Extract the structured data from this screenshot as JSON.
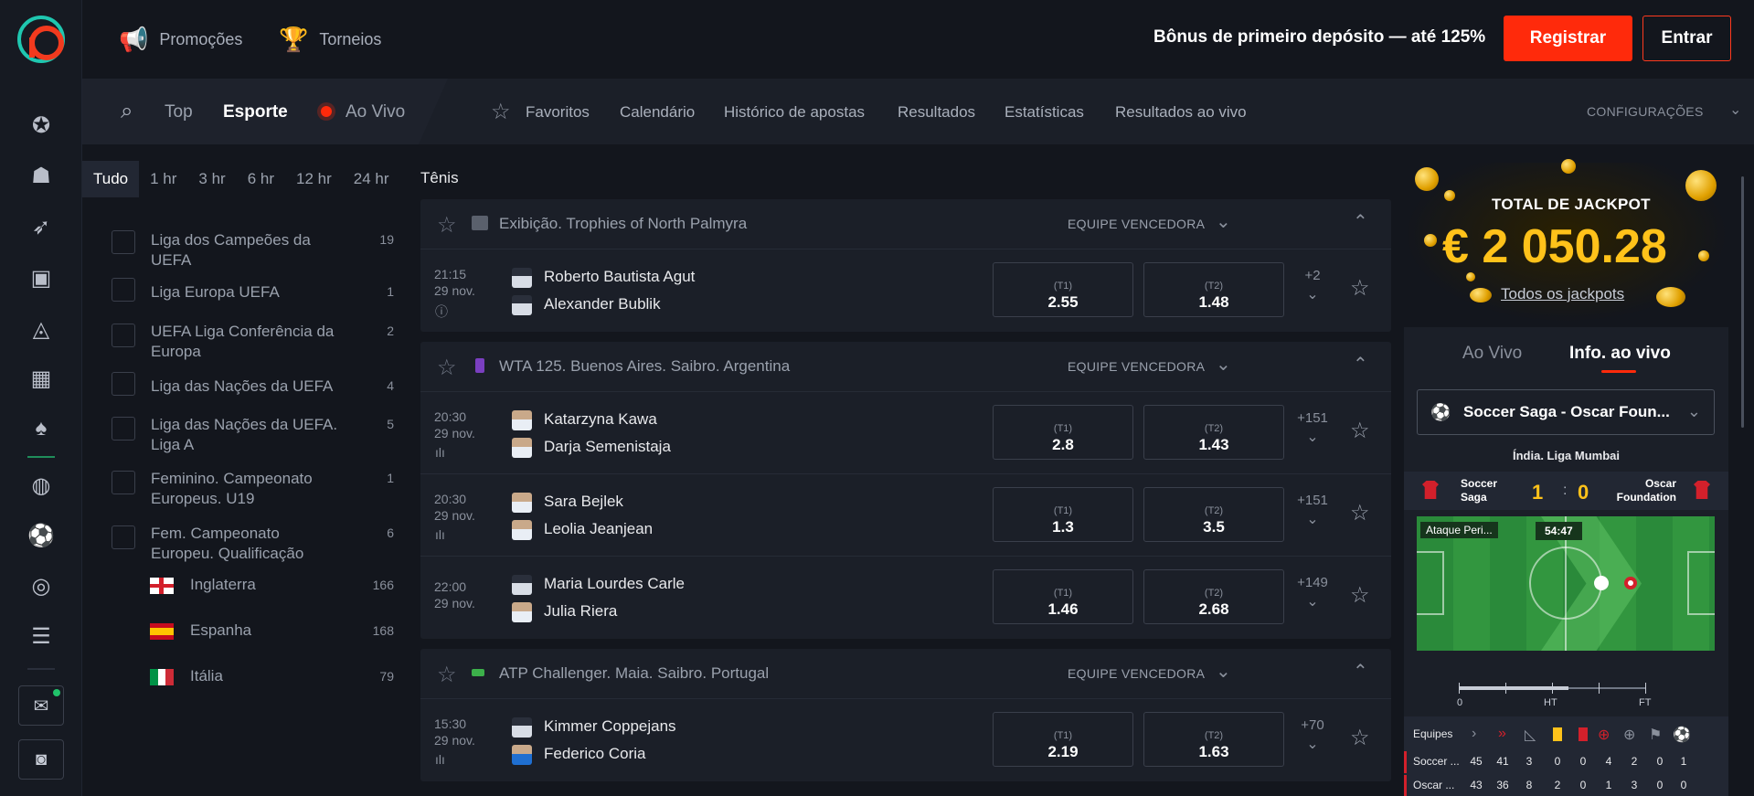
{
  "topbar": {
    "promocoes": "Promoções",
    "torneios": "Torneios",
    "bonus": "Bônus de primeiro depósito — até 125%",
    "registrar": "Registrar",
    "entrar": "Entrar"
  },
  "subnav": {
    "top": "Top",
    "esporte": "Esporte",
    "ao_vivo": "Ao Vivo",
    "favoritos": "Favoritos",
    "calendario": "Calendário",
    "historico": "Histórico de apostas",
    "resultados": "Resultados",
    "estatisticas": "Estatísticas",
    "resultados_ao_vivo": "Resultados ao vivo",
    "configuracoes": "CONFIGURAÇÕES"
  },
  "time_filters": [
    "Tudo",
    "1 hr",
    "3 hr",
    "6 hr",
    "12 hr",
    "24 hr"
  ],
  "leagues": [
    {
      "name": "Liga dos Campeões da UEFA",
      "count": "19"
    },
    {
      "name": "Liga Europa UEFA",
      "count": "1"
    },
    {
      "name": "UEFA Liga Conferência da Europa",
      "count": "2"
    },
    {
      "name": "Liga das Nações da UEFA",
      "count": "4"
    },
    {
      "name": "Liga das Nações da UEFA. Liga A",
      "count": "5"
    },
    {
      "name": "Feminino. Campeonato Europeus. U19",
      "count": "1"
    },
    {
      "name": "Fem. Campeonato Europeu. Qualificação",
      "count": "6"
    }
  ],
  "countries": [
    {
      "name": "Inglaterra",
      "count": "166"
    },
    {
      "name": "Espanha",
      "count": "168"
    },
    {
      "name": "Itália",
      "count": "79"
    }
  ],
  "sport_title": "Tênis",
  "market_label": "EQUIPE VENCEDORA",
  "blocks": [
    {
      "league": "Exibição. Trophies of North Palmyra",
      "matches": [
        {
          "time": "21:15",
          "date": "29 nov.",
          "p1": "Roberto Bautista Agut",
          "p2": "Alexander Bublik",
          "o1_label": "(T1)",
          "o1": "2.55",
          "o2_label": "(T2)",
          "o2": "1.48",
          "more": "+2"
        }
      ]
    },
    {
      "league": "WTA 125. Buenos Aires. Saibro. Argentina",
      "matches": [
        {
          "time": "20:30",
          "date": "29 nov.",
          "p1": "Katarzyna Kawa",
          "p2": "Darja Semenistaja",
          "o1_label": "(T1)",
          "o1": "2.8",
          "o2_label": "(T2)",
          "o2": "1.43",
          "more": "+151"
        },
        {
          "time": "20:30",
          "date": "29 nov.",
          "p1": "Sara Bejlek",
          "p2": "Leolia Jeanjean",
          "o1_label": "(T1)",
          "o1": "1.3",
          "o2_label": "(T2)",
          "o2": "3.5",
          "more": "+151"
        },
        {
          "time": "22:00",
          "date": "29 nov.",
          "p1": "Maria Lourdes Carle",
          "p2": "Julia Riera",
          "o1_label": "(T1)",
          "o1": "1.46",
          "o2_label": "(T2)",
          "o2": "2.68",
          "more": "+149"
        }
      ]
    },
    {
      "league": "ATP Challenger. Maia. Saibro. Portugal",
      "matches": [
        {
          "time": "15:30",
          "date": "29 nov.",
          "p1": "Kimmer Coppejans",
          "p2": "Federico Coria",
          "o1_label": "(T1)",
          "o1": "2.19",
          "o2_label": "(T2)",
          "o2": "1.63",
          "more": "+70"
        }
      ]
    }
  ],
  "jackpot": {
    "title": "TOTAL DE JACKPOT",
    "amount": "€ 2 050.28",
    "link": "Todos os jackpots"
  },
  "right_tabs": {
    "ao_vivo": "Ao Vivo",
    "info": "Info. ao vivo"
  },
  "live": {
    "match_select": "Soccer Saga - Oscar Foun...",
    "league": "Índia. Liga Mumbai",
    "team1": "Soccer Saga",
    "team2": "Oscar Foundation",
    "score1": "1",
    "score2": "0",
    "attack_tag": "Ataque Peri...",
    "clock": "54:47",
    "tl_0": "0",
    "tl_ht": "HT",
    "tl_ft": "FT",
    "stats_header": "Equipes",
    "row1_name": "Soccer ...",
    "row1": [
      "45",
      "41",
      "3",
      "0",
      "0",
      "4",
      "2",
      "0",
      "1"
    ],
    "row2_name": "Oscar ...",
    "row2": [
      "43",
      "36",
      "8",
      "2",
      "0",
      "1",
      "3",
      "0",
      "0"
    ]
  },
  "colors": {
    "accent": "#ff2a0b",
    "gold": "#ffc21a",
    "bg": "#13161d",
    "panel": "#1b1f28"
  }
}
